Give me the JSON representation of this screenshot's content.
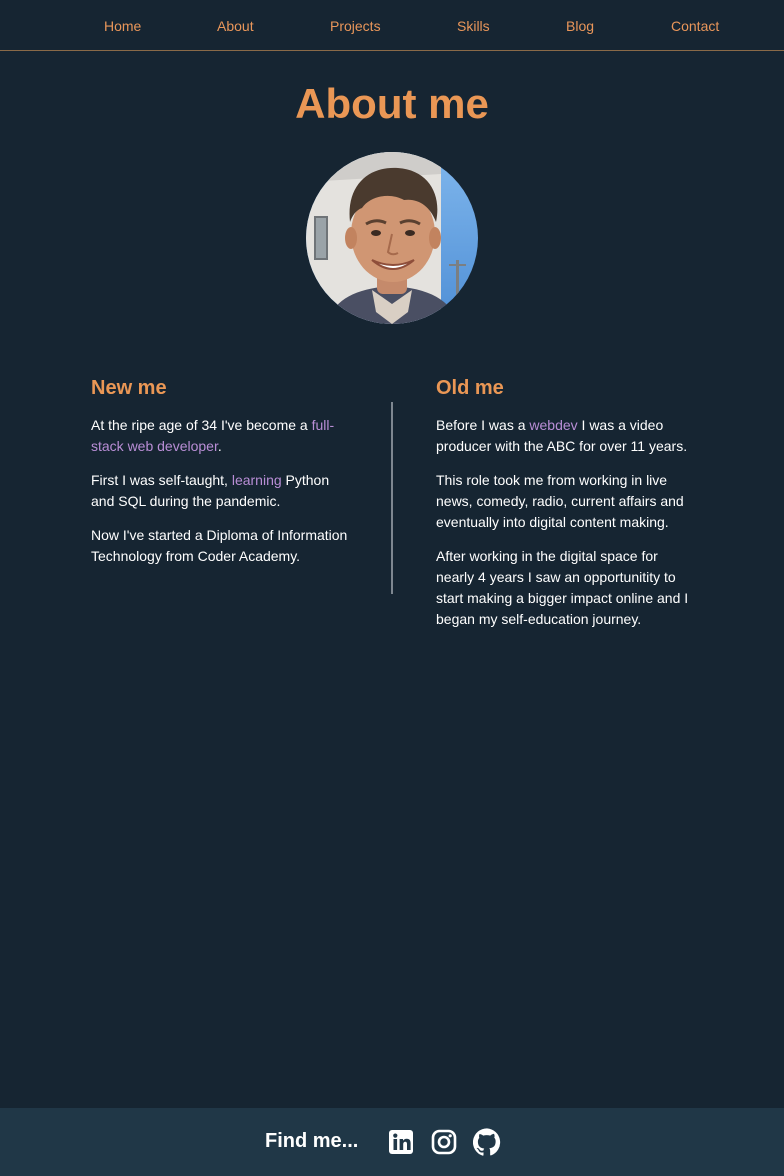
{
  "nav": {
    "home": "Home",
    "about": "About",
    "projects": "Projects",
    "skills": "Skills",
    "blog": "Blog",
    "contact": "Contact"
  },
  "page": {
    "title": "About me"
  },
  "new_me": {
    "heading": "New me",
    "p1_before": "At the ripe age of 34 I've become a ",
    "p1_link": "full-stack web developer",
    "p1_after": ".",
    "p2_before": "First I was self-taught, ",
    "p2_link": "learning",
    "p2_after": " Python and SQL during the pandemic.",
    "p3": "Now I've started a Diploma of Information Technology from Coder Academy."
  },
  "old_me": {
    "heading": "Old me",
    "p1_before": "Before I was a ",
    "p1_link": "webdev",
    "p1_after": " I was a video producer with the ABC for over 11 years.",
    "p2": "This role took me from working in live news, comedy, radio, current affairs and eventually into digital content making.",
    "p3": "After working in the digital space for nearly 4 years I saw an opportunitity to start making a bigger impact online and I began my self-education journey."
  },
  "footer": {
    "label": "Find me...",
    "icons": [
      "linkedin-icon",
      "instagram-icon",
      "github-icon"
    ]
  },
  "colors": {
    "background": "#162532",
    "accent": "#ea9755",
    "link": "#b98ed6",
    "footer_bg": "#203747"
  }
}
